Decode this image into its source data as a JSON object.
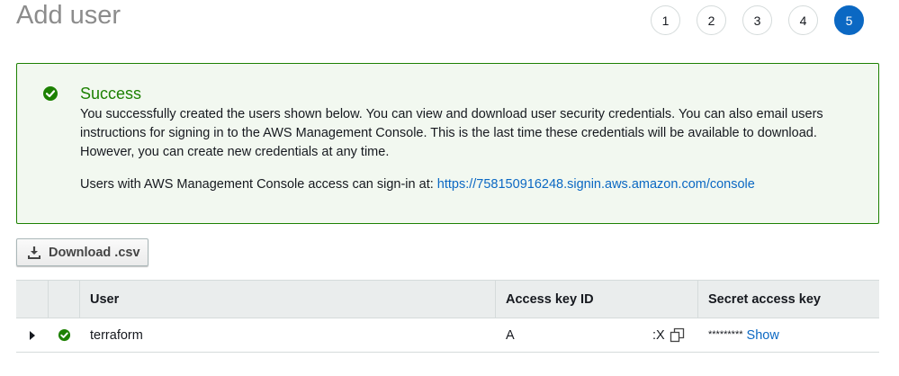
{
  "page": {
    "title": "Add user"
  },
  "steps": [
    "1",
    "2",
    "3",
    "4",
    "5"
  ],
  "active_step": 5,
  "alert": {
    "title": "Success",
    "message": "You successfully created the users shown below. You can view and download user security credentials. You can also email users instructions for signing in to the AWS Management Console. This is the last time these credentials will be available to download. However, you can create new credentials at any time.",
    "signin_prefix": "Users with AWS Management Console access can sign-in at:",
    "signin_url": "https://758150916248.signin.aws.amazon.com/console"
  },
  "download_button": {
    "label": "Download .csv"
  },
  "table": {
    "headers": {
      "user": "User",
      "access_key_id": "Access key ID",
      "secret_access_key": "Secret access key"
    },
    "rows": [
      {
        "user": "terraform",
        "access_key_prefix": "A",
        "access_key_suffix": ":X",
        "secret_mask": "*********",
        "show_label": "Show"
      }
    ]
  },
  "colors": {
    "success": "#1d8102",
    "link": "#0b68c3",
    "active_step": "#0b68c3"
  },
  "icons": {
    "success": "check-circle-icon",
    "download": "download-icon",
    "copy": "copy-icon",
    "expand": "caret-right-icon"
  }
}
